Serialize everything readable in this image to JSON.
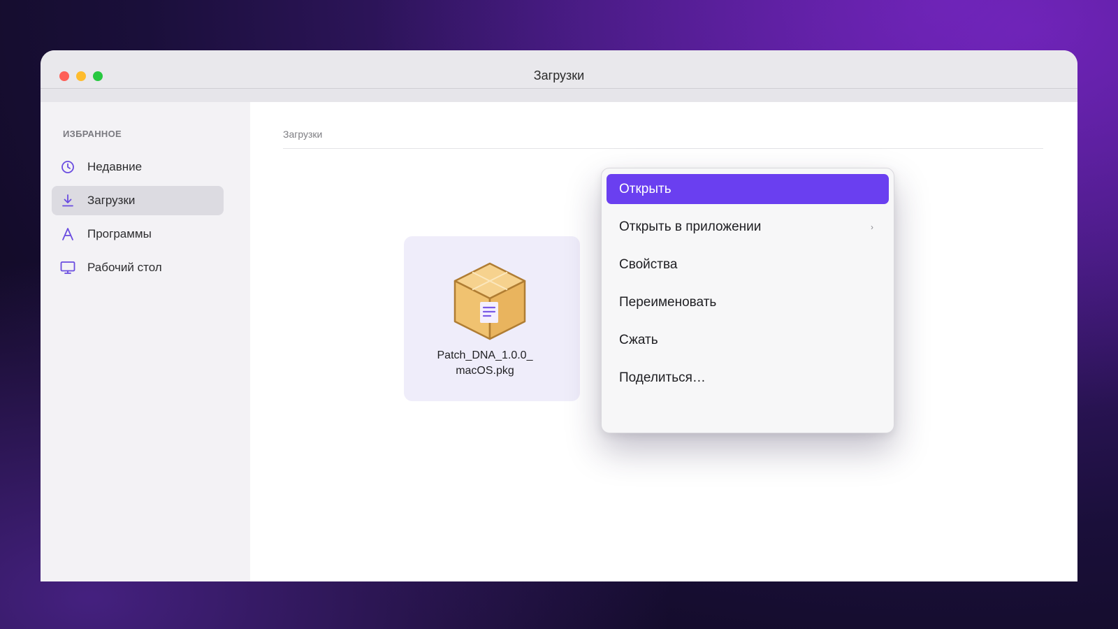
{
  "window": {
    "title": "Загрузки"
  },
  "sidebar": {
    "heading": "ИЗБРАННОЕ",
    "items": [
      {
        "label": "Недавние",
        "icon": "clock-icon",
        "active": false
      },
      {
        "label": "Загрузки",
        "icon": "download-icon",
        "active": true
      },
      {
        "label": "Программы",
        "icon": "apps-icon",
        "active": false
      },
      {
        "label": "Рабочий стол",
        "icon": "monitor-icon",
        "active": false
      }
    ]
  },
  "main": {
    "breadcrumb": "Загрузки",
    "file": {
      "name_line1": "Patch_DNA_1.0.0_",
      "name_line2": "macOS.pkg",
      "icon": "package-icon"
    }
  },
  "context_menu": {
    "items": [
      {
        "label": "Открыть",
        "highlighted": true
      },
      {
        "label": "Открыть в приложении",
        "submenu": true,
        "chevron": "›"
      },
      {
        "label": "Свойства"
      },
      {
        "label": "Переименовать"
      },
      {
        "label": "Сжать"
      },
      {
        "label": "Поделиться…"
      }
    ]
  },
  "colors": {
    "accent": "#6a3ff0",
    "icon_purple": "#6a4ce0",
    "box_fill": "#f2c87a",
    "box_stroke": "#b07d33"
  }
}
